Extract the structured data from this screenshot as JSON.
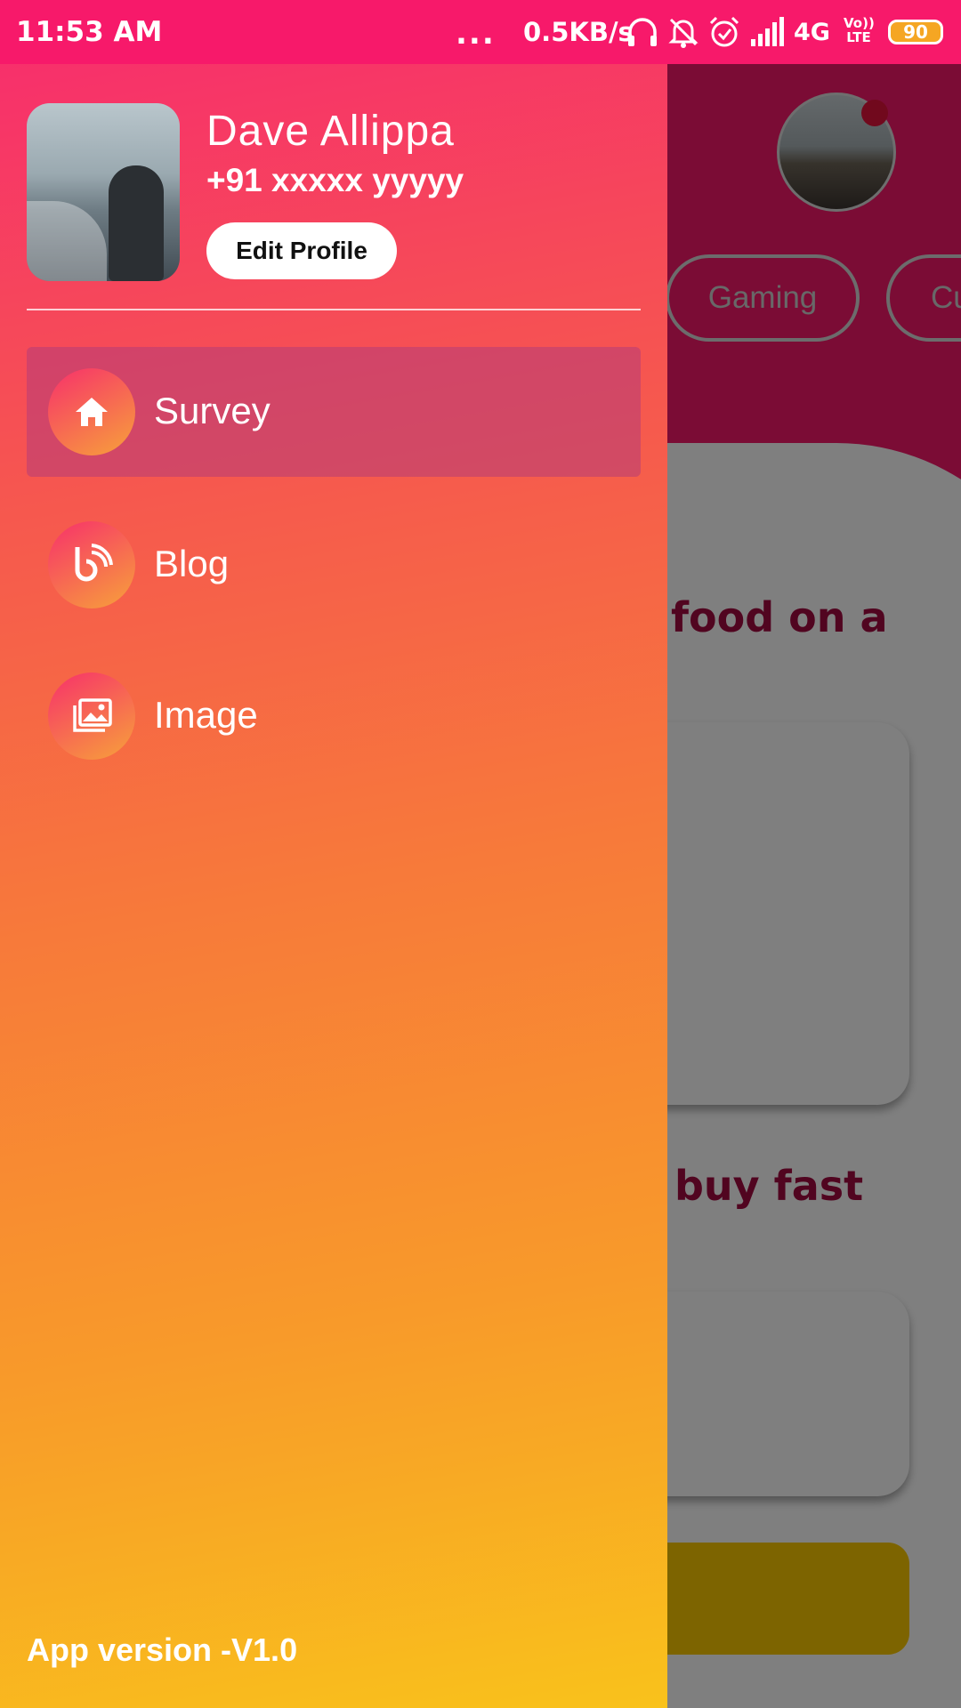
{
  "status_bar": {
    "time": "11:53 AM",
    "dots": "...",
    "speed": "0.5KB/s",
    "network": "4G",
    "volte_top": "Vo))",
    "volte_bottom": "LTE",
    "battery": "90",
    "icons": [
      "headphones-icon",
      "mute-notification-icon",
      "alarm-icon",
      "signal-icon"
    ]
  },
  "background": {
    "chips": [
      "Gaming",
      "Cu"
    ],
    "heading1": "food on a",
    "heading2": "buy fast"
  },
  "drawer": {
    "profile": {
      "name": "Dave Allippa",
      "phone": "+91 xxxxx yyyyy",
      "edit_label": "Edit Profile"
    },
    "menu": [
      {
        "label": "Survey",
        "icon": "home-icon",
        "active": true
      },
      {
        "label": "Blog",
        "icon": "rss-icon",
        "active": false
      },
      {
        "label": "Image",
        "icon": "image-gallery-icon",
        "active": false
      }
    ],
    "app_version": "App version -V1.0"
  },
  "colors": {
    "status_bar": "#f7196a",
    "accent": "#f7306b",
    "gradient_end": "#f9c21b"
  }
}
